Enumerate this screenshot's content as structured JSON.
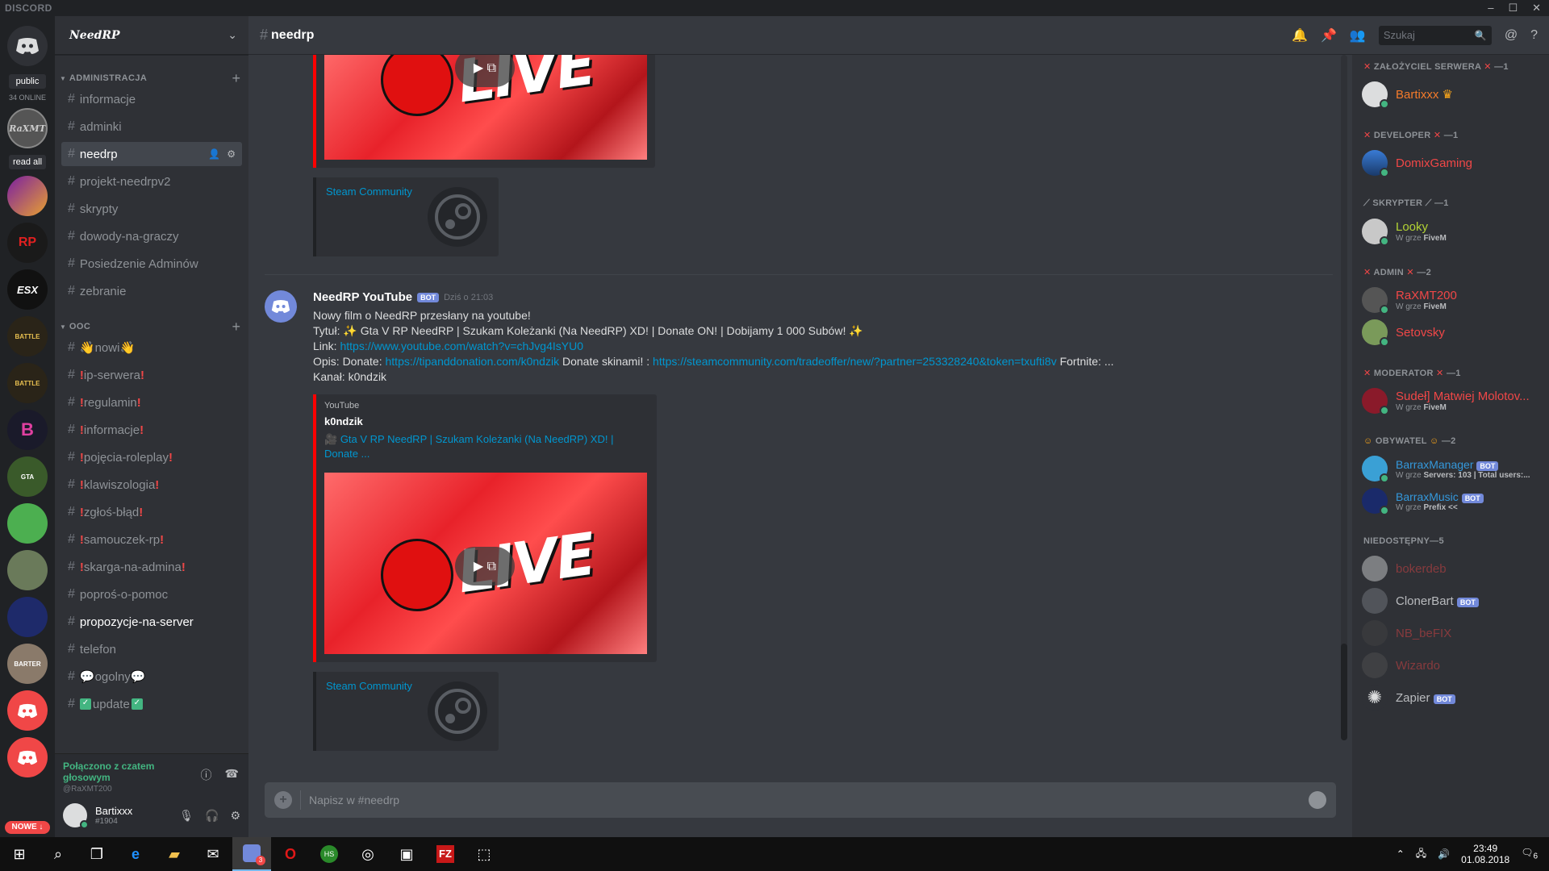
{
  "titlebar": {
    "brand": "DISCORD",
    "minimize": "–",
    "maximize": "☐",
    "close": "✕"
  },
  "guilds": {
    "public_label": "public",
    "online_label": "34 ONLINE",
    "read_all": "read all",
    "new_label": "NOWE ↓"
  },
  "server": {
    "name": "NeedRP"
  },
  "categories": [
    {
      "label": "ADMINISTRACJA"
    },
    {
      "label": "OOC"
    }
  ],
  "channels_admin": [
    {
      "name": "informacje"
    },
    {
      "name": "adminki"
    },
    {
      "name": "needrp"
    },
    {
      "name": "projekt-needrpv2"
    },
    {
      "name": "skrypty"
    },
    {
      "name": "dowody-na-graczy"
    },
    {
      "name": "Posiedzenie Adminów"
    },
    {
      "name": "zebranie"
    }
  ],
  "channels_ooc": [
    {
      "name": "nowi"
    },
    {
      "name": "ip-serwera"
    },
    {
      "name": "regulamin"
    },
    {
      "name": "informacje"
    },
    {
      "name": "pojęcia-roleplay"
    },
    {
      "name": "klawiszologia"
    },
    {
      "name": "zgłoś-błąd"
    },
    {
      "name": "samouczek-rp"
    },
    {
      "name": "skarga-na-admina"
    },
    {
      "name": "poproś-o-pomoc"
    },
    {
      "name": "propozycje-na-server"
    },
    {
      "name": "telefon"
    },
    {
      "name": "ogolny"
    },
    {
      "name": "update"
    }
  ],
  "voice": {
    "status": "Połączono z czatem głosowym",
    "server": "@RaXMT200"
  },
  "user": {
    "name": "Bartixxx",
    "discriminator": "#1904"
  },
  "header": {
    "channel": "needrp",
    "search_placeholder": "Szukaj"
  },
  "message": {
    "author": "NeedRP YouTube",
    "bot_tag": "BOT",
    "time": "Dziś o 21:03",
    "line1": "Nowy film o NeedRP przesłany na youtube!",
    "title_label": "Tytuł:",
    "title_value": "Gta V RP NeedRP | Szukam Koleżanki (Na NeedRP) XD! | Donate ON! | Dobijamy 1 000 Subów!",
    "link_label": "Link:",
    "link_value": "https://www.youtube.com/watch?v=chJvg4IsYU0",
    "desc_label": "Opis: Donate:",
    "desc_link1": "https://tipanddonation.com/k0ndzik",
    "desc_mid": "Donate skinami! :",
    "desc_link2": "https://steamcommunity.com/tradeoffer/new/?partner=253328240&token=txufti8v",
    "desc_end": "Fortnite: ...",
    "channel_line": "Kanał: k0ndzik"
  },
  "embed": {
    "provider": "YouTube",
    "author": "k0ndzik",
    "title": "Gta V RP NeedRP | Szukam Koleżanki (Na NeedRP) XD! | Donate ...",
    "thumb_text": "LIVE",
    "steam_title": "Steam Community"
  },
  "composer": {
    "placeholder": "Napisz w #needrp"
  },
  "members": {
    "roles": [
      {
        "label": "ZAŁOŻYCIEL SERWERA",
        "count": "—1"
      },
      {
        "label": "DEVELOPER",
        "count": "—1"
      },
      {
        "label": "SKRYPTER",
        "count": "—1"
      },
      {
        "label": "ADMIN",
        "count": "—2"
      },
      {
        "label": "MODERATOR",
        "count": "—1"
      },
      {
        "label": "OBYWATEL",
        "count": "—2"
      },
      {
        "label": "NIEDOSTĘPNY—5",
        "count": ""
      }
    ],
    "list": [
      {
        "name": "Bartixxx",
        "color": "#f47b2b",
        "sub": ""
      },
      {
        "name": "DomixGaming",
        "color": "#f04747",
        "sub": ""
      },
      {
        "name": "Looky",
        "color": "#b3d334",
        "sub_label": "W grze",
        "sub_game": "FiveM"
      },
      {
        "name": "RaXMT200",
        "color": "#f04747",
        "sub_label": "W grze",
        "sub_game": "FiveM"
      },
      {
        "name": "Setovsky",
        "color": "#f04747",
        "sub": ""
      },
      {
        "name": "Sudeł] Matwiej Molotov...",
        "color": "#f04747",
        "sub_label": "W grze",
        "sub_game": "FiveM"
      },
      {
        "name": "BarraxManager",
        "color": "#3498db",
        "sub_label": "W grze",
        "sub_game": "Servers: 103 | Total users:..."
      },
      {
        "name": "BarraxMusic",
        "color": "#3498db",
        "sub_label": "W grze",
        "sub_game": "Prefix <<"
      },
      {
        "name": "bokerdeb",
        "color": "#f04747"
      },
      {
        "name": "ClonerBart",
        "color": "#b9bbbe"
      },
      {
        "name": "NB_beFIX",
        "color": "#f04747"
      },
      {
        "name": "Wizardo",
        "color": "#f04747"
      },
      {
        "name": "Zapier",
        "color": "#b9bbbe"
      }
    ]
  },
  "taskbar": {
    "time": "23:49",
    "date": "01.08.2018",
    "notif": "6",
    "discord_badge": "3"
  }
}
